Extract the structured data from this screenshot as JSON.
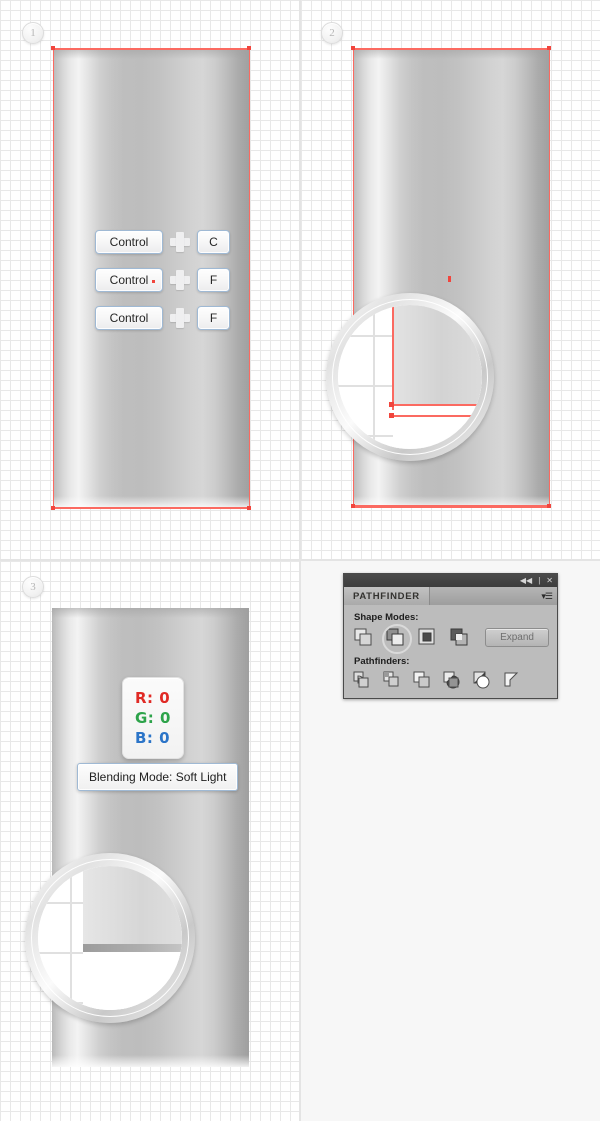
{
  "canvas": {
    "background_color": "#ffffff",
    "grid_minor_color": "#e8e8e8",
    "grid_major_color": "#d8d8d8"
  },
  "steps": [
    {
      "number": "1"
    },
    {
      "number": "2"
    },
    {
      "number": "3"
    }
  ],
  "panel1": {
    "shortcuts": [
      {
        "modifier": "Control",
        "plus": "+",
        "key": "C"
      },
      {
        "modifier": "Control",
        "plus": "+",
        "key": "F"
      },
      {
        "modifier": "Control",
        "plus": "+",
        "key": "F"
      }
    ],
    "selection_color": "#fb6a61"
  },
  "panel3": {
    "color_readout": {
      "r_label": "R:",
      "r_value": "0",
      "r_color": "#e02a25",
      "g_label": "G:",
      "g_value": "0",
      "g_color": "#2da34a",
      "b_label": "B:",
      "b_value": "0",
      "b_color": "#2b74c8"
    },
    "tooltip": "Blending Mode: Soft Light"
  },
  "pathfinder": {
    "title": "PATHFINDER",
    "collapse_icon": "◀◀",
    "separator": "|",
    "close_icon": "✕",
    "menu_icon": "▾☰",
    "shape_modes_label": "Shape Modes:",
    "pathfinders_label": "Pathfinders:",
    "expand_label": "Expand",
    "shape_modes": [
      {
        "name": "unite",
        "selected": false
      },
      {
        "name": "minus-front",
        "selected": true
      },
      {
        "name": "intersect",
        "selected": false
      },
      {
        "name": "exclude",
        "selected": false
      }
    ],
    "pathfinders": [
      {
        "name": "divide"
      },
      {
        "name": "trim"
      },
      {
        "name": "merge"
      },
      {
        "name": "crop"
      },
      {
        "name": "outline"
      },
      {
        "name": "minus-back"
      }
    ]
  }
}
